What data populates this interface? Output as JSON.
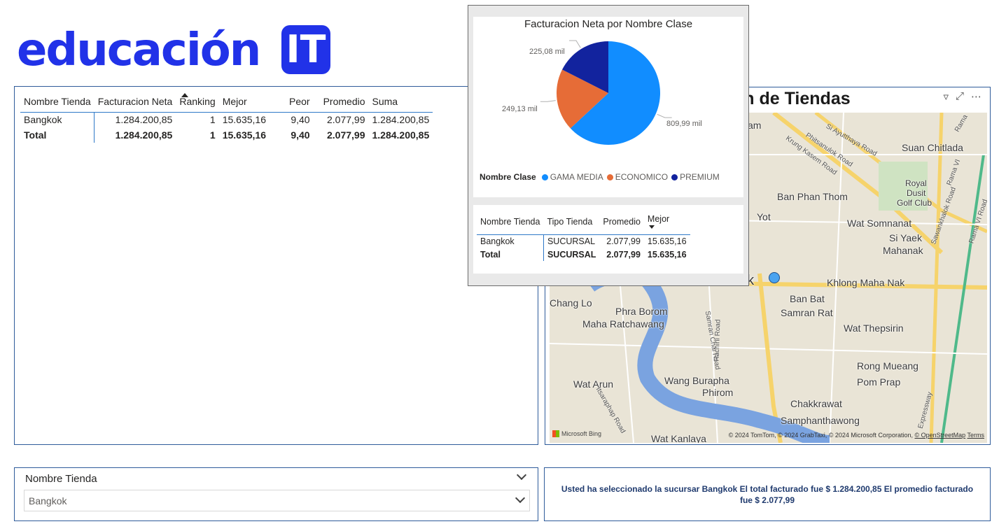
{
  "logo": {
    "text": "educación",
    "badge": "IT"
  },
  "main_table": {
    "headers": [
      "Nombre Tienda",
      "Facturacion Neta",
      "Ranking",
      "Mejor",
      "Peor",
      "Promedio",
      "Suma"
    ],
    "rows": [
      [
        "Bangkok",
        "1.284.200,85",
        "1",
        "15.635,16",
        "9,40",
        "2.077,99",
        "1.284.200,85"
      ]
    ],
    "total": [
      "Total",
      "1.284.200,85",
      "1",
      "15.635,16",
      "9,40",
      "2.077,99",
      "1.284.200,85"
    ]
  },
  "map": {
    "title": "on de Tiendas",
    "places": [
      "Suan Chitlada",
      "Royal",
      "Dusit",
      "Golf Club",
      "Ban Phan Thom",
      "Yot",
      "Wat Somnanat",
      "Si Yaek",
      "Mahanak",
      "Khlong Maha Nak",
      "Ban Bat",
      "Samran Rat",
      "Wat Thepsirin",
      "Chang Lo",
      "Phra Borom",
      "Maha Ratchawang",
      "Rong Mueang",
      "Pom Prap",
      "Wat Arun",
      "Wang Burapha",
      "Phirom",
      "Chakkrawat",
      "Samphanthawong",
      "Wat Kanlaya",
      "am",
      "ok"
    ],
    "roads": [
      "Si Ayutthaya Road",
      "Phitsanulok Road",
      "Krung Kasem Road",
      "Rama VI",
      "Sawankhalok Road",
      "Rama VI Road",
      "Samran Chai Road",
      "Rachini Road",
      "Itsaraphap Road",
      "Expressway",
      "Rama"
    ],
    "credit": "© 2024 TomTom, © 2024 GrabTaxi, © 2024 Microsoft Corporation,",
    "credit_link": "© OpenStreetMap",
    "terms": "Terms",
    "bing": "Microsoft Bing"
  },
  "popup": {
    "pie_title": "Facturacion Neta por Nombre Clase",
    "legend_title": "Nombre Clase",
    "slice_labels": [
      "809,99 mil",
      "249,13 mil",
      "225,08 mil"
    ],
    "table": {
      "headers": [
        "Nombre Tienda",
        "Tipo Tienda",
        "Promedio",
        "Mejor"
      ],
      "rows": [
        [
          "Bangkok",
          "SUCURSAL",
          "2.077,99",
          "15.635,16"
        ]
      ],
      "total": [
        "Total",
        "SUCURSAL",
        "2.077,99",
        "15.635,16"
      ]
    }
  },
  "chart_data": {
    "type": "pie",
    "title": "Facturacion Neta por Nombre Clase",
    "legend_title": "Nombre Clase",
    "legend_position": "bottom",
    "categories": [
      "GAMA MEDIA",
      "ECONOMICO",
      "PREMIUM"
    ],
    "values": [
      809.99,
      249.13,
      225.08
    ],
    "unit": "mil",
    "colors": [
      "#118dff",
      "#e66c37",
      "#12239e"
    ]
  },
  "slicer": {
    "header": "Nombre Tienda",
    "value": "Bangkok"
  },
  "text_card": {
    "message": "Usted ha seleccionado la sucursar Bangkok El total facturado fue $ 1.284.200,85 El promedio facturado fue $ 2.077,99"
  },
  "colors": {
    "brand": "#2132e8",
    "border": "#2e5b9a",
    "accent_line": "#2e78c8"
  }
}
